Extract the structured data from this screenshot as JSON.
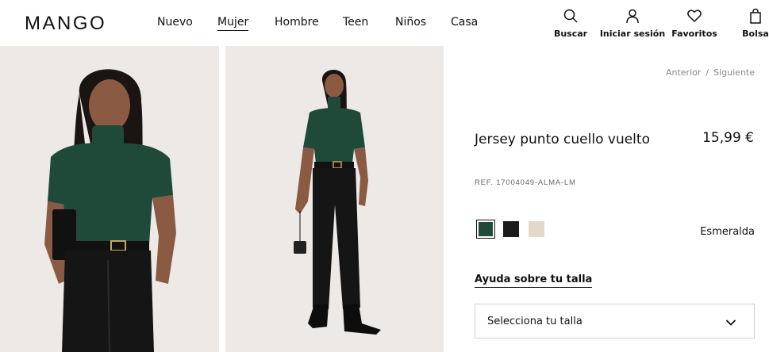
{
  "brand": {
    "logo": "MANGO"
  },
  "nav": {
    "items": [
      {
        "label": "Nuevo",
        "active": false
      },
      {
        "label": "Mujer",
        "active": true
      },
      {
        "label": "Hombre",
        "active": false
      },
      {
        "label": "Teen",
        "active": false
      },
      {
        "label": "Niños",
        "active": false
      },
      {
        "label": "Casa",
        "active": false
      }
    ]
  },
  "tools": [
    {
      "label": "Buscar",
      "icon": "search-icon"
    },
    {
      "label": "Iniciar sesión",
      "icon": "user-icon"
    },
    {
      "label": "Favoritos",
      "icon": "heart-icon"
    },
    {
      "label": "Bolsa",
      "icon": "bag-icon"
    }
  ],
  "pager": {
    "previous": "Anterior",
    "separator": "/",
    "next": "Siguiente"
  },
  "product": {
    "title": "Jersey punto cuello vuelto",
    "price": "15,99 €",
    "ref": "REF. 17004049-ALMA-LM",
    "selected_color": "Esmeralda",
    "colors": [
      {
        "hex": "#1f4a3a",
        "selected": true
      },
      {
        "hex": "#1c1c1f",
        "selected": false
      },
      {
        "hex": "#e4d9c9",
        "selected": false
      }
    ],
    "size_help": "Ayuda sobre tu talla",
    "size_select_placeholder": "Selecciona tu talla"
  },
  "colors": {
    "background": "#ffffff",
    "photo_bg": "#ece9e6",
    "text": "#111111",
    "muted": "#888888"
  }
}
